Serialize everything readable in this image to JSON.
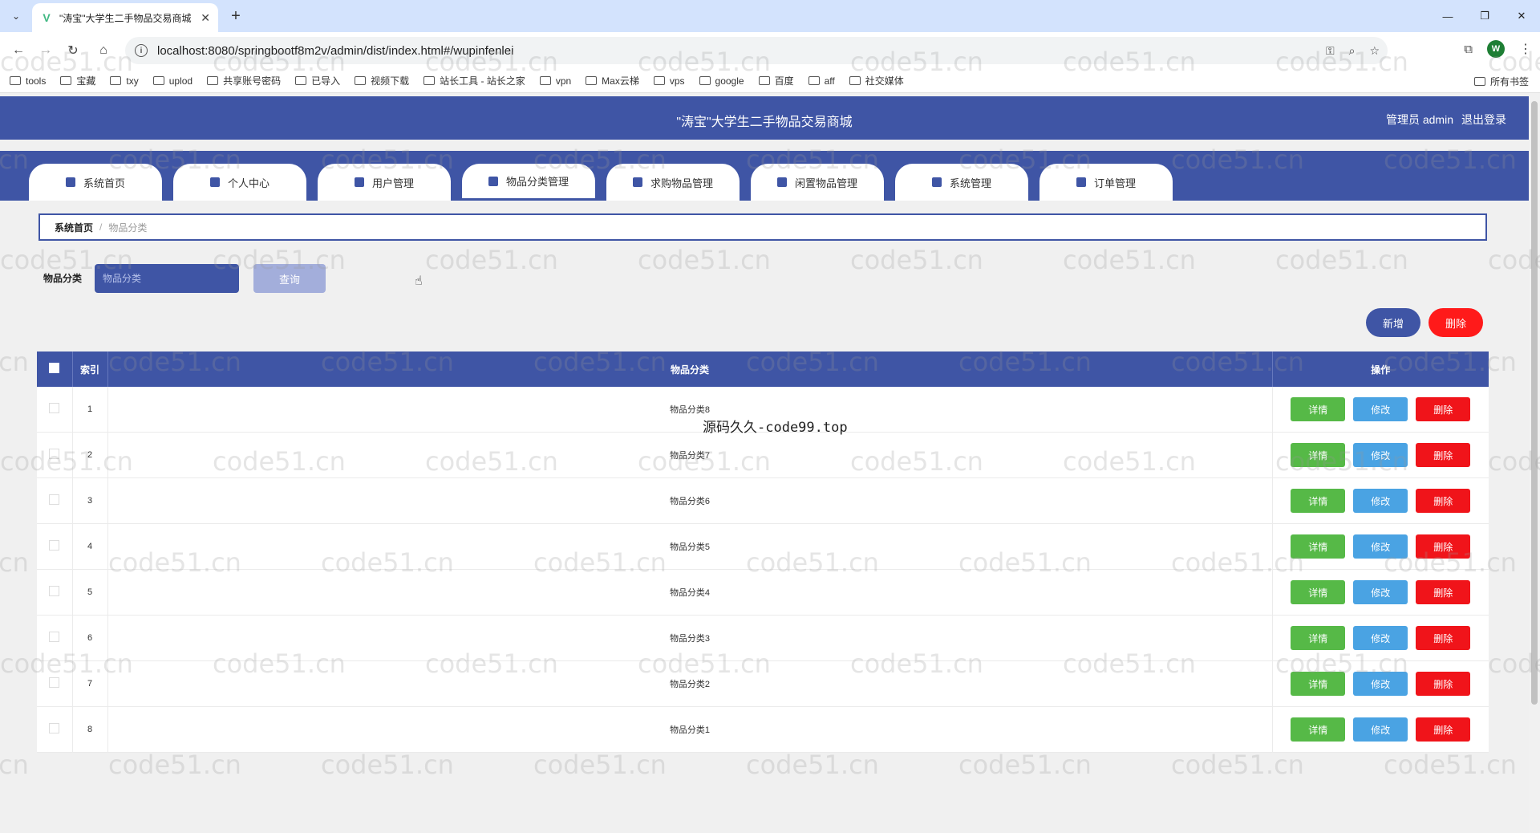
{
  "browser": {
    "tab_title": "\"涛宝\"大学生二手物品交易商城",
    "url": "localhost:8080/springbootf8m2v/admin/dist/index.html#/wupinfenlei",
    "profile_initial": "W",
    "bookmarks": [
      "tools",
      "宝藏",
      "txy",
      "uplod",
      "共享账号密码",
      "已导入",
      "视频下载",
      "站长工具 - 站长之家",
      "vpn",
      "Max云梯",
      "vps",
      "google",
      "百度",
      "aff",
      "社交媒体"
    ],
    "all_bookmarks": "所有书签"
  },
  "app": {
    "title": "\"涛宝\"大学生二手物品交易商城",
    "user_label": "管理员 admin",
    "logout_label": "退出登录"
  },
  "menu": [
    {
      "label": "系统首页",
      "icon": "home-icon"
    },
    {
      "label": "个人中心",
      "icon": "user-icon"
    },
    {
      "label": "用户管理",
      "icon": "bar-chart-icon"
    },
    {
      "label": "物品分类管理",
      "icon": "clipboard-icon"
    },
    {
      "label": "求购物品管理",
      "icon": "grid-icon"
    },
    {
      "label": "闲置物品管理",
      "icon": "columns-icon"
    },
    {
      "label": "系统管理",
      "icon": "person-icon"
    },
    {
      "label": "订单管理",
      "icon": "chat-icon"
    }
  ],
  "breadcrumb": {
    "home": "系统首页",
    "current": "物品分类"
  },
  "search": {
    "label": "物品分类",
    "placeholder": "物品分类",
    "button": "查询"
  },
  "actions": {
    "add": "新增",
    "delete": "删除"
  },
  "table": {
    "headers": {
      "index": "索引",
      "category": "物品分类",
      "ops": "操作"
    },
    "rows": [
      {
        "index": "1",
        "category": "物品分类8"
      },
      {
        "index": "2",
        "category": "物品分类7"
      },
      {
        "index": "3",
        "category": "物品分类6"
      },
      {
        "index": "4",
        "category": "物品分类5"
      },
      {
        "index": "5",
        "category": "物品分类4"
      },
      {
        "index": "6",
        "category": "物品分类3"
      },
      {
        "index": "7",
        "category": "物品分类2"
      },
      {
        "index": "8",
        "category": "物品分类1"
      }
    ],
    "row_buttons": {
      "detail": "详情",
      "edit": "修改",
      "delete": "删除"
    }
  },
  "overlay_text": "源码久久-code99.top",
  "watermark": "code51.cn",
  "colors": {
    "primary": "#3f55a5",
    "danger": "#ff1a1a",
    "success": "#56b947",
    "info": "#4aa3e3"
  }
}
